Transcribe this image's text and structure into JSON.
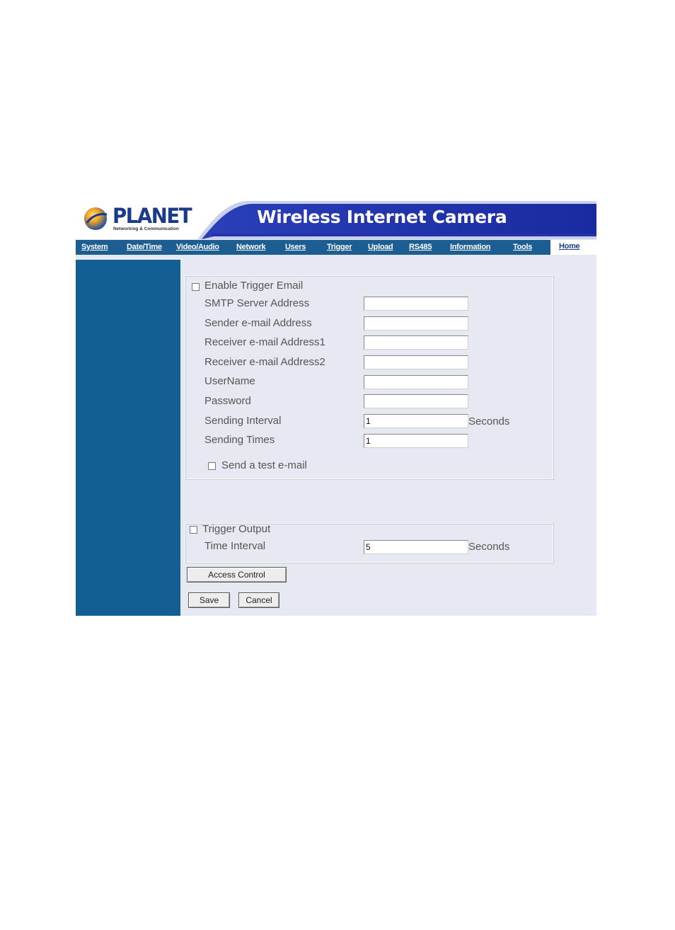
{
  "brand": {
    "logo_text": "PLANET",
    "logo_subtitle": "Networking & Communication",
    "banner_title": "Wireless Internet Camera"
  },
  "nav": {
    "items": [
      "System",
      "Date/Time",
      "Video/Audio",
      "Network",
      "Users",
      "Trigger",
      "Upload",
      "RS485",
      "Information",
      "Tools"
    ],
    "home": "Home"
  },
  "email": {
    "enable_label": "Enable Trigger Email",
    "enable_checked": false,
    "fields": [
      {
        "label": "SMTP Server Address",
        "value": ""
      },
      {
        "label": "Sender e-mail Address",
        "value": ""
      },
      {
        "label": "Receiver e-mail Address1",
        "value": ""
      },
      {
        "label": "Receiver e-mail Address2",
        "value": ""
      },
      {
        "label": "UserName",
        "value": ""
      },
      {
        "label": "Password",
        "value": ""
      },
      {
        "label": "Sending Interval",
        "value": "1",
        "unit": "Seconds"
      },
      {
        "label": "Sending Times",
        "value": "1"
      }
    ],
    "test_label": "Send a test e-mail",
    "test_checked": false
  },
  "output": {
    "enable_label": "Trigger Output",
    "enable_checked": false,
    "interval_label": "Time Interval",
    "interval_value": "5",
    "interval_unit": "Seconds"
  },
  "buttons": {
    "access_control": "Access Control",
    "save": "Save",
    "cancel": "Cancel"
  },
  "colors": {
    "nav_bg": "#1d5e92",
    "sidebar_bg": "#135e92",
    "content_bg": "#e6e9f1",
    "banner_blue": "#1a2fa8"
  }
}
